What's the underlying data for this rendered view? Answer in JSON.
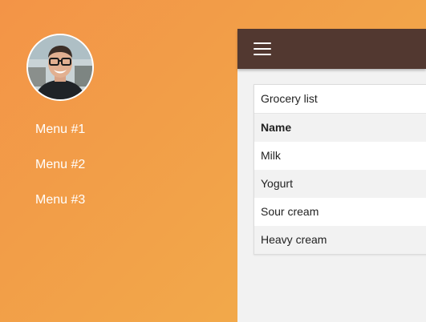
{
  "sidebar": {
    "avatar_alt": "user avatar",
    "menu": [
      {
        "label": "Menu #1"
      },
      {
        "label": "Menu #2"
      },
      {
        "label": "Menu #3"
      }
    ]
  },
  "topbar": {
    "menu_icon": "hamburger-menu-icon",
    "background_color": "#523830"
  },
  "grocery_card": {
    "title": "Grocery list",
    "column_header": "Name",
    "rows": [
      {
        "name": "Milk"
      },
      {
        "name": "Yogurt"
      },
      {
        "name": "Sour cream"
      },
      {
        "name": "Heavy cream"
      }
    ]
  },
  "colors": {
    "gradient_start": "#f39447",
    "gradient_end": "#f3b04c",
    "content_background": "#f2f2f2"
  }
}
